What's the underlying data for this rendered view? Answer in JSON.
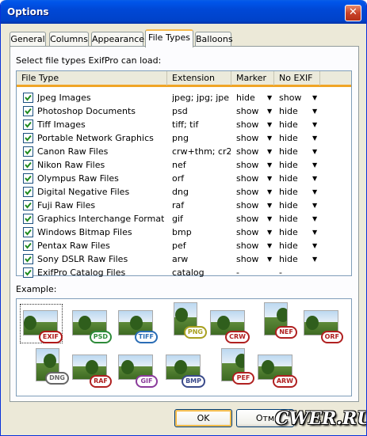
{
  "window": {
    "title": "Options",
    "close_glyph": "✕"
  },
  "tabs": [
    "General",
    "Columns",
    "Appearance",
    "File Types",
    "Balloons"
  ],
  "active_tab": "File Types",
  "select_label": "Select file types ExifPro can load:",
  "columns": {
    "file_type": "File Type",
    "extension": "Extension",
    "marker": "Marker",
    "no_exif": "No EXIF"
  },
  "dropdown_glyph": "▼",
  "rows": [
    {
      "name": "Jpeg Images",
      "ext": "jpeg; jpg; jpe",
      "marker": "hide",
      "noexif": "show",
      "checked": true
    },
    {
      "name": "Photoshop Documents",
      "ext": "psd",
      "marker": "show",
      "noexif": "hide",
      "checked": true
    },
    {
      "name": "Tiff Images",
      "ext": "tiff; tif",
      "marker": "show",
      "noexif": "hide",
      "checked": true
    },
    {
      "name": "Portable Network Graphics",
      "ext": "png",
      "marker": "show",
      "noexif": "hide",
      "checked": true
    },
    {
      "name": "Canon Raw Files",
      "ext": "crw+thm; cr2",
      "marker": "show",
      "noexif": "hide",
      "checked": true
    },
    {
      "name": "Nikon Raw Files",
      "ext": "nef",
      "marker": "show",
      "noexif": "hide",
      "checked": true
    },
    {
      "name": "Olympus Raw Files",
      "ext": "orf",
      "marker": "show",
      "noexif": "hide",
      "checked": true
    },
    {
      "name": "Digital Negative Files",
      "ext": "dng",
      "marker": "show",
      "noexif": "hide",
      "checked": true
    },
    {
      "name": "Fuji Raw Files",
      "ext": "raf",
      "marker": "show",
      "noexif": "hide",
      "checked": true
    },
    {
      "name": "Graphics Interchange Format",
      "ext": "gif",
      "marker": "show",
      "noexif": "hide",
      "checked": true
    },
    {
      "name": "Windows Bitmap Files",
      "ext": "bmp",
      "marker": "show",
      "noexif": "hide",
      "checked": true
    },
    {
      "name": "Pentax Raw Files",
      "ext": "pef",
      "marker": "show",
      "noexif": "hide",
      "checked": true
    },
    {
      "name": "Sony DSLR Raw Files",
      "ext": "arw",
      "marker": "show",
      "noexif": "hide",
      "checked": true
    },
    {
      "name": "ExifPro Catalog Files",
      "ext": "catalog",
      "marker": "-",
      "noexif": "-",
      "checked": true
    }
  ],
  "example_label": "Example:",
  "examples": [
    {
      "label": "EXIF",
      "color": "#b01818",
      "icon": "no-exif-icon"
    },
    {
      "label": "PSD",
      "color": "#2e8b3a"
    },
    {
      "label": "TIFF",
      "color": "#2a6db5"
    },
    {
      "label": "PNG",
      "color": "#a8a020"
    },
    {
      "label": "CRW",
      "color": "#b02020"
    },
    {
      "label": "NEF",
      "color": "#b02020"
    },
    {
      "label": "ORF",
      "color": "#b02020"
    },
    {
      "label": "DNG",
      "color": "#666666"
    },
    {
      "label": "RAF",
      "color": "#b02020"
    },
    {
      "label": "GIF",
      "color": "#8a3a9a"
    },
    {
      "label": "BMP",
      "color": "#3a4a8a"
    },
    {
      "label": "PEF",
      "color": "#b02020"
    },
    {
      "label": "ARW",
      "color": "#b02020"
    }
  ],
  "buttons": {
    "ok": "OK",
    "cancel": "Отм"
  },
  "watermark": "CWER.RU",
  "colors": {
    "titlebar": "#0048d6",
    "header_accent": "#f0a526",
    "check": "#1f8a1f"
  }
}
